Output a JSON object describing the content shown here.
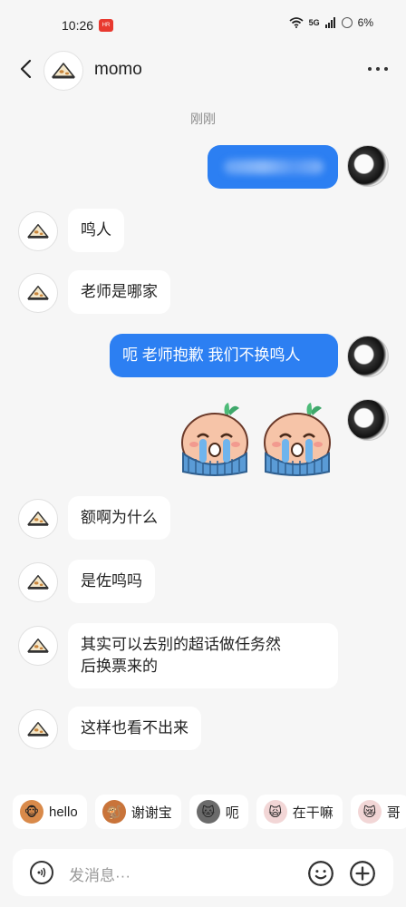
{
  "status_bar": {
    "time": "10:26",
    "badge": "HR",
    "signal": "5G",
    "battery": "6%"
  },
  "header": {
    "title": "momo"
  },
  "timestamp": "刚刚",
  "messages": [
    {
      "side": "right",
      "text": ""
    },
    {
      "side": "left",
      "text": "鸣人"
    },
    {
      "side": "left",
      "text": "老师是哪家"
    },
    {
      "side": "right",
      "text": "呃 老师抱歉 我们不换鸣人"
    },
    {
      "side": "right",
      "type": "stickers"
    },
    {
      "side": "left",
      "text": "额啊为什么"
    },
    {
      "side": "left",
      "text": "是佐鸣吗"
    },
    {
      "side": "left",
      "lines": [
        "其实可以去别的超话做任务然",
        "后换票来的"
      ]
    },
    {
      "side": "left",
      "text": "这样也看不出来"
    }
  ],
  "quick_replies": [
    {
      "label": "hello",
      "icon": "monkey-sticker-icon"
    },
    {
      "label": "谢谢宝",
      "icon": "monkey-sticker-icon"
    },
    {
      "label": "呃",
      "icon": "cat-sticker-icon"
    },
    {
      "label": "在干嘛",
      "icon": "cartoon-sticker-icon"
    },
    {
      "label": "哥",
      "icon": "cartoon-sticker-icon"
    }
  ],
  "input": {
    "placeholder": "发消息···"
  },
  "colors": {
    "accent": "#2c7ff2",
    "background": "#f6f6f6",
    "bubble_left": "#ffffff"
  }
}
